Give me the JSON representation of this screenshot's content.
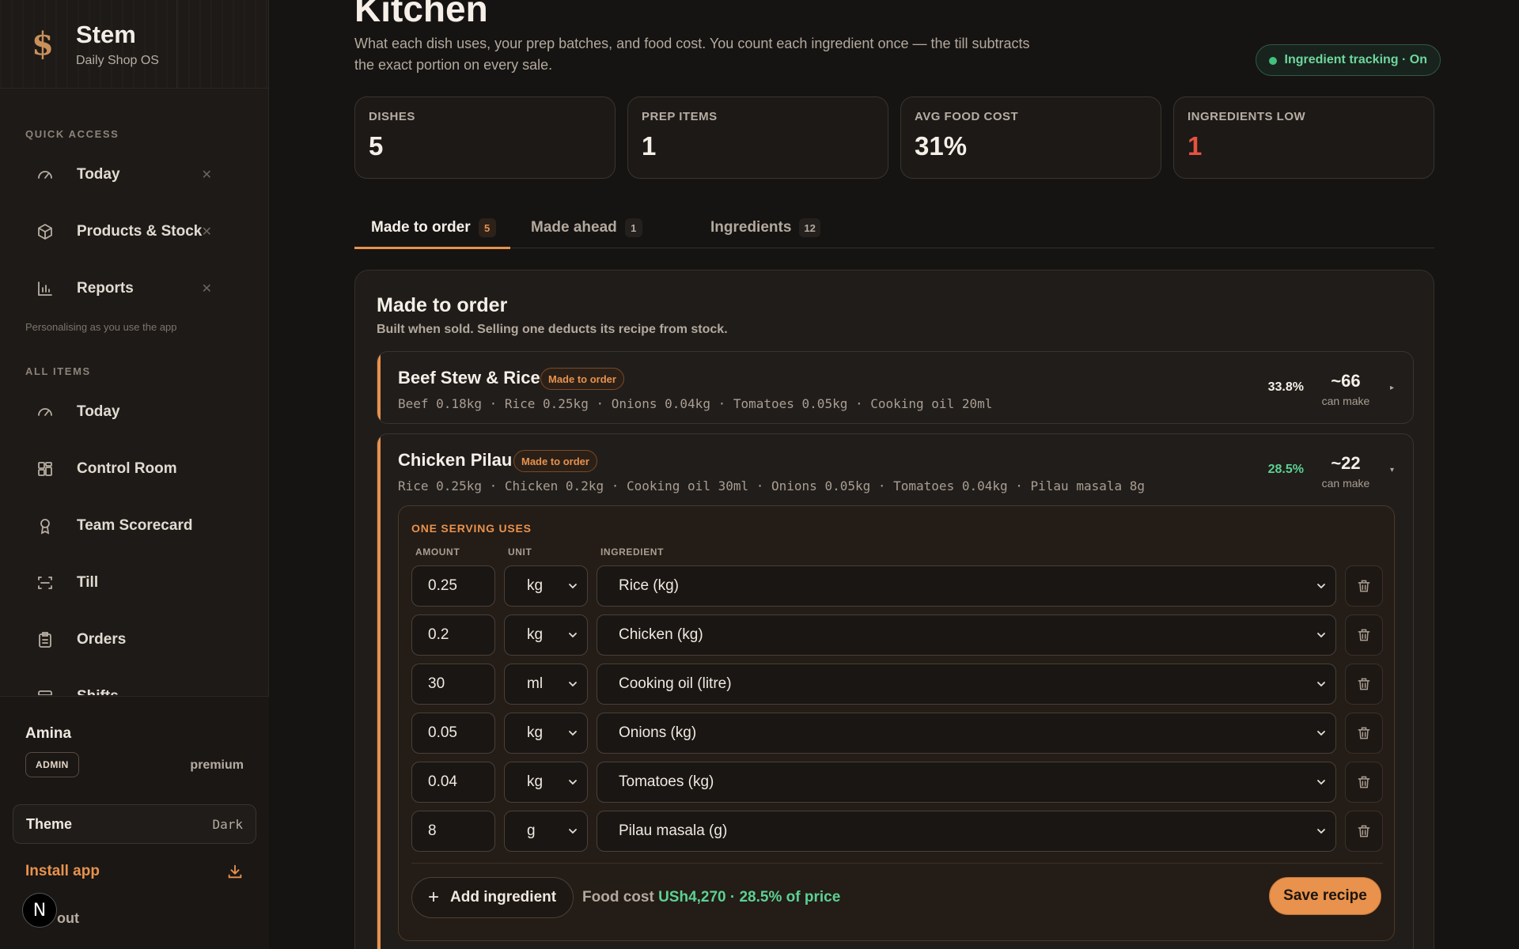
{
  "brand": {
    "name": "Stem",
    "subtitle": "Daily Shop OS",
    "logo": "$"
  },
  "sidebar": {
    "quick_access_label": "QUICK ACCESS",
    "quick_access": [
      {
        "label": "Today",
        "icon": "gauge-icon"
      },
      {
        "label": "Products & Stock",
        "icon": "box-icon"
      },
      {
        "label": "Reports",
        "icon": "bar-chart-icon"
      }
    ],
    "hint": "Personalising as you use the app",
    "all_items_label": "ALL ITEMS",
    "all_items": [
      {
        "label": "Today",
        "icon": "gauge-icon"
      },
      {
        "label": "Control Room",
        "icon": "grid-icon"
      },
      {
        "label": "Team Scorecard",
        "icon": "award-icon"
      },
      {
        "label": "Till",
        "icon": "scan-icon"
      },
      {
        "label": "Orders",
        "icon": "clipboard-icon"
      },
      {
        "label": "Shifts",
        "icon": "shifts-icon"
      }
    ],
    "user": {
      "name": "Amina",
      "role": "ADMIN",
      "plan": "premium"
    },
    "theme": {
      "label": "Theme",
      "value": "Dark"
    },
    "install": "Install app",
    "logout": "out",
    "avatar_letter": "N"
  },
  "header": {
    "title": "Kitchen",
    "description": "What each dish uses, your prep batches, and food cost. You count each ingredient once — the till subtracts the exact portion on every sale.",
    "tracking_badge": "Ingredient tracking · On"
  },
  "stats": [
    {
      "label": "DISHES",
      "value": "5"
    },
    {
      "label": "PREP ITEMS",
      "value": "1"
    },
    {
      "label": "AVG FOOD COST",
      "value": "31%"
    },
    {
      "label": "INGREDIENTS LOW",
      "value": "1"
    }
  ],
  "tabs": [
    {
      "label": "Made to order",
      "count": "5",
      "active": true
    },
    {
      "label": "Made ahead",
      "count": "1"
    },
    {
      "label": "Ingredients",
      "count": "12"
    }
  ],
  "section": {
    "title": "Made to order",
    "subtitle": "Built when sold. Selling one deducts its recipe from stock."
  },
  "dishes": [
    {
      "name": "Beef Stew & Rice",
      "tag": "Made to order",
      "ingredients": "Beef 0.18kg · Rice 0.25kg · Onions 0.04kg · Tomatoes 0.05kg · Cooking oil 20ml",
      "cost_pct": "33.8%",
      "can_make": "~66",
      "can_make_label": "can make"
    },
    {
      "name": "Chicken Pilau",
      "tag": "Made to order",
      "ingredients": "Rice 0.25kg · Chicken 0.2kg · Cooking oil 30ml · Onions 0.05kg · Tomatoes 0.04kg · Pilau masala 8g",
      "cost_pct": "28.5%",
      "can_make": "~22",
      "can_make_label": "can make"
    }
  ],
  "serving": {
    "heading": "ONE SERVING USES",
    "col_amount": "AMOUNT",
    "col_unit": "UNIT",
    "col_ingredient": "INGREDIENT",
    "rows": [
      {
        "amount": "0.25",
        "unit": "kg",
        "ingredient": "Rice (kg)"
      },
      {
        "amount": "0.2",
        "unit": "kg",
        "ingredient": "Chicken (kg)"
      },
      {
        "amount": "30",
        "unit": "ml",
        "ingredient": "Cooking oil (litre)"
      },
      {
        "amount": "0.05",
        "unit": "kg",
        "ingredient": "Onions (kg)"
      },
      {
        "amount": "0.04",
        "unit": "kg",
        "ingredient": "Tomatoes (kg)"
      },
      {
        "amount": "8",
        "unit": "g",
        "ingredient": "Pilau masala (g)"
      }
    ],
    "add_label": "Add ingredient",
    "food_cost_label": "Food cost",
    "food_cost_value": "USh4,270 · 28.5% of price",
    "save_label": "Save recipe"
  },
  "colors": {
    "accent": "#e8924d",
    "success": "#5bd193",
    "danger": "#e5533e",
    "background": "#161412"
  }
}
